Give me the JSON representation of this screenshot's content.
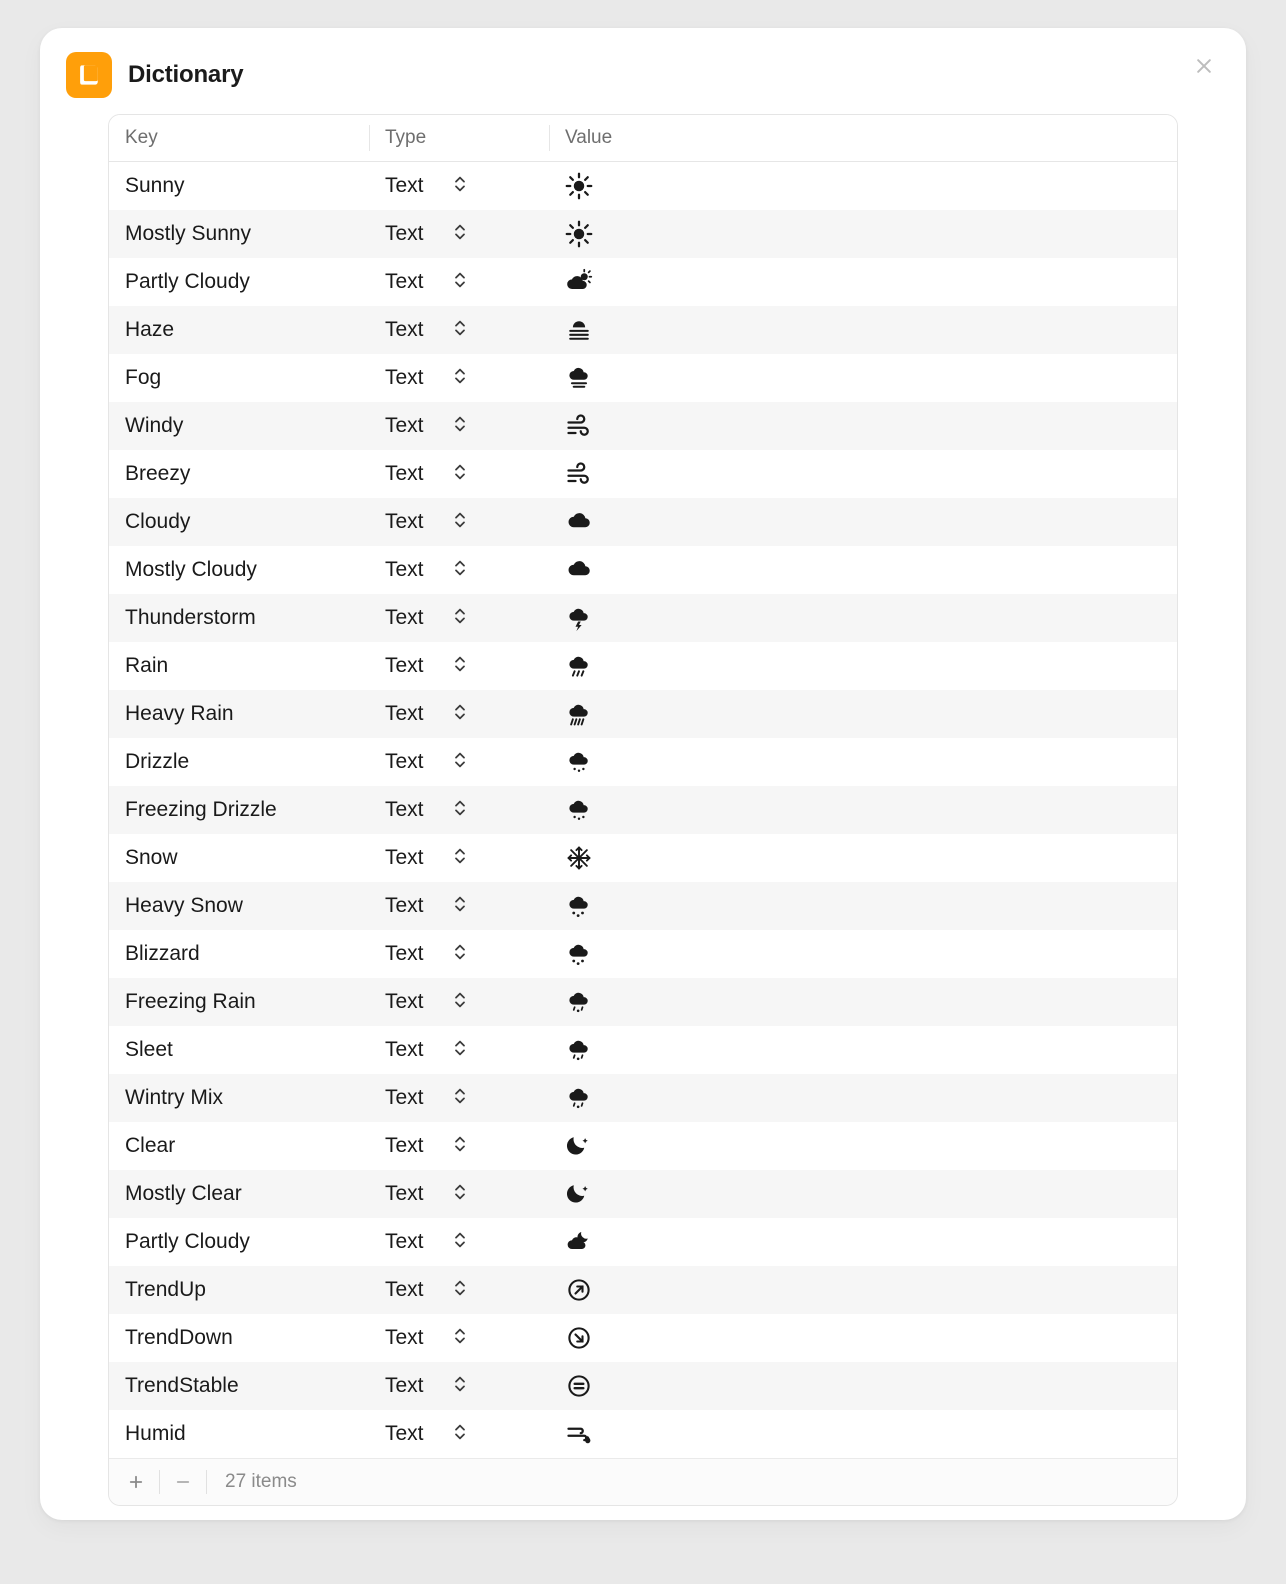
{
  "title": "Dictionary",
  "columns": {
    "key": "Key",
    "type": "Type",
    "value": "Value"
  },
  "typeLabel": "Text",
  "footer": {
    "items_label": "27 items"
  },
  "rows": [
    {
      "key": "Sunny",
      "type": "Text",
      "icon": "sun"
    },
    {
      "key": "Mostly Sunny",
      "type": "Text",
      "icon": "sun"
    },
    {
      "key": "Partly Cloudy",
      "type": "Text",
      "icon": "cloud-sun"
    },
    {
      "key": "Haze",
      "type": "Text",
      "icon": "haze"
    },
    {
      "key": "Fog",
      "type": "Text",
      "icon": "fog"
    },
    {
      "key": "Windy",
      "type": "Text",
      "icon": "wind"
    },
    {
      "key": "Breezy",
      "type": "Text",
      "icon": "wind"
    },
    {
      "key": "Cloudy",
      "type": "Text",
      "icon": "cloud"
    },
    {
      "key": "Mostly Cloudy",
      "type": "Text",
      "icon": "cloud"
    },
    {
      "key": "Thunderstorm",
      "type": "Text",
      "icon": "cloud-bolt"
    },
    {
      "key": "Rain",
      "type": "Text",
      "icon": "cloud-rain"
    },
    {
      "key": "Heavy Rain",
      "type": "Text",
      "icon": "cloud-heavy-rain"
    },
    {
      "key": "Drizzle",
      "type": "Text",
      "icon": "cloud-drizzle"
    },
    {
      "key": "Freezing Drizzle",
      "type": "Text",
      "icon": "cloud-drizzle"
    },
    {
      "key": "Snow",
      "type": "Text",
      "icon": "snowflake"
    },
    {
      "key": "Heavy Snow",
      "type": "Text",
      "icon": "cloud-snow"
    },
    {
      "key": "Blizzard",
      "type": "Text",
      "icon": "cloud-snow"
    },
    {
      "key": "Freezing Rain",
      "type": "Text",
      "icon": "cloud-sleet"
    },
    {
      "key": "Sleet",
      "type": "Text",
      "icon": "cloud-sleet"
    },
    {
      "key": "Wintry Mix",
      "type": "Text",
      "icon": "cloud-sleet"
    },
    {
      "key": "Clear",
      "type": "Text",
      "icon": "moon"
    },
    {
      "key": "Mostly Clear",
      "type": "Text",
      "icon": "moon"
    },
    {
      "key": "Partly Cloudy",
      "type": "Text",
      "icon": "cloud-moon"
    },
    {
      "key": "TrendUp",
      "type": "Text",
      "icon": "arrow-up-circle"
    },
    {
      "key": "TrendDown",
      "type": "Text",
      "icon": "arrow-down-circle"
    },
    {
      "key": "TrendStable",
      "type": "Text",
      "icon": "equal-circle"
    },
    {
      "key": "Humid",
      "type": "Text",
      "icon": "humidity"
    }
  ]
}
